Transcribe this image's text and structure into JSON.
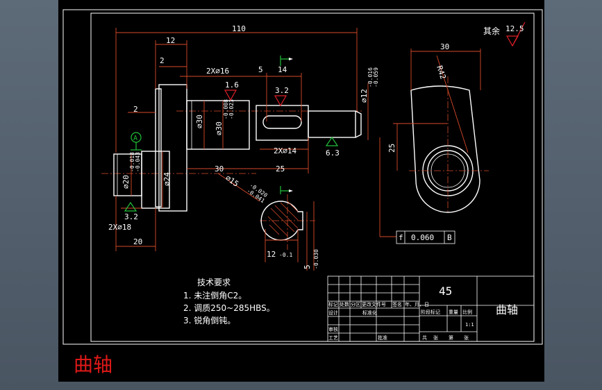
{
  "caption": "曲轴",
  "title_block": {
    "material": "45",
    "part_name": "曲轴",
    "row_labels": [
      "标记",
      "处数",
      "分区",
      "更改文件号",
      "签名",
      "年、月、日"
    ],
    "left_labels": [
      "设计",
      "标准化",
      "审核",
      "工艺",
      "批准"
    ],
    "stage_labels": [
      "阶段标记",
      "重量",
      "比例"
    ],
    "scale": "1:1",
    "sheet": [
      "共",
      "张",
      "第",
      "张"
    ]
  },
  "tech_req": {
    "title": "技术要求",
    "items": [
      "1. 未注倒角C2。",
      "2. 调质250~285HBS。",
      "3. 锐角倒钝。"
    ]
  },
  "roughness_other": {
    "label": "其余",
    "value": "12.5"
  },
  "datum": "A",
  "dimensions": {
    "overall": "110",
    "d12": "12",
    "d2_top": "2",
    "chamfer_2x16": "2X∅16",
    "d5": "5",
    "d14": "14",
    "roughness_16": "1.6",
    "roughness_32a": "3.2",
    "d2_left": "2",
    "dia30": "∅30",
    "dia30_tol": "∅30",
    "dia30_tol_up": "-0.008",
    "dia30_tol_low": "-0.023",
    "dia12_tol": "∅12",
    "dia12_up": "-0.016",
    "dia12_low": "-0.059",
    "chamfer_2x14": "2X∅14",
    "roughness_63": "6.3",
    "dia20": "∅20",
    "dia20_up": "-0.018",
    "dia20_low": "-0.043",
    "dia24": "∅24",
    "d30": "30",
    "d25": "25",
    "dia15": "∅15",
    "dia15_up": "-0.020",
    "dia15_low": "-0.041",
    "roughness_32b": "3.2",
    "chamfer_2x18": "2X∅18",
    "d20": "20",
    "key_12": "12",
    "key_12_tol": "-0.1",
    "key_5": "5",
    "key_5_tol": "-0.030",
    "crank_30": "30",
    "crank_r42": "R42",
    "crank_25": "25"
  },
  "tolerance_frame": {
    "symbol": "f",
    "value": "0.060",
    "datum": "B"
  }
}
